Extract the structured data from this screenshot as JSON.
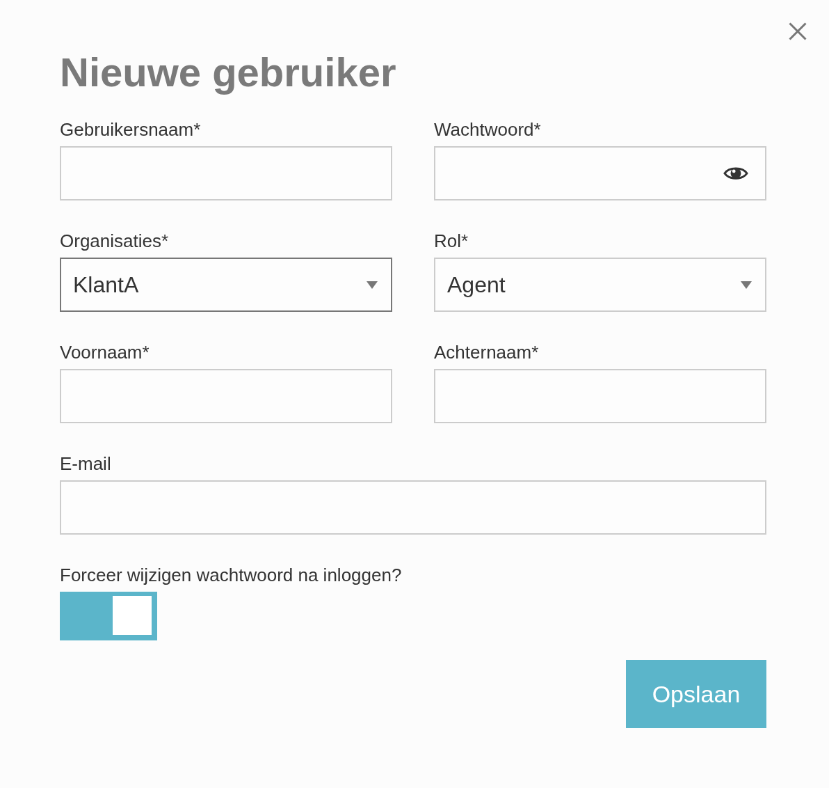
{
  "title": "Nieuwe gebruiker",
  "rows": [
    [
      {
        "kind": "text",
        "label": "Gebruikersnaam*",
        "focused": false
      },
      {
        "kind": "password",
        "label": "Wachtwoord*",
        "focused": false
      }
    ],
    [
      {
        "kind": "select",
        "label": "Organisaties*",
        "value": "KlantA",
        "focused": true
      },
      {
        "kind": "select",
        "label": "Rol*",
        "value": "Agent",
        "focused": false
      }
    ],
    [
      {
        "kind": "text",
        "label": "Voornaam*",
        "focused": false
      },
      {
        "kind": "text",
        "label": "Achternaam*",
        "focused": false
      }
    ],
    [
      {
        "kind": "text",
        "label": "E-mail",
        "focused": false
      }
    ]
  ],
  "toggle": {
    "label": "Forceer wijzigen wachtwoord na inloggen?",
    "on": true
  },
  "save_button": {
    "label": "Opslaan"
  }
}
